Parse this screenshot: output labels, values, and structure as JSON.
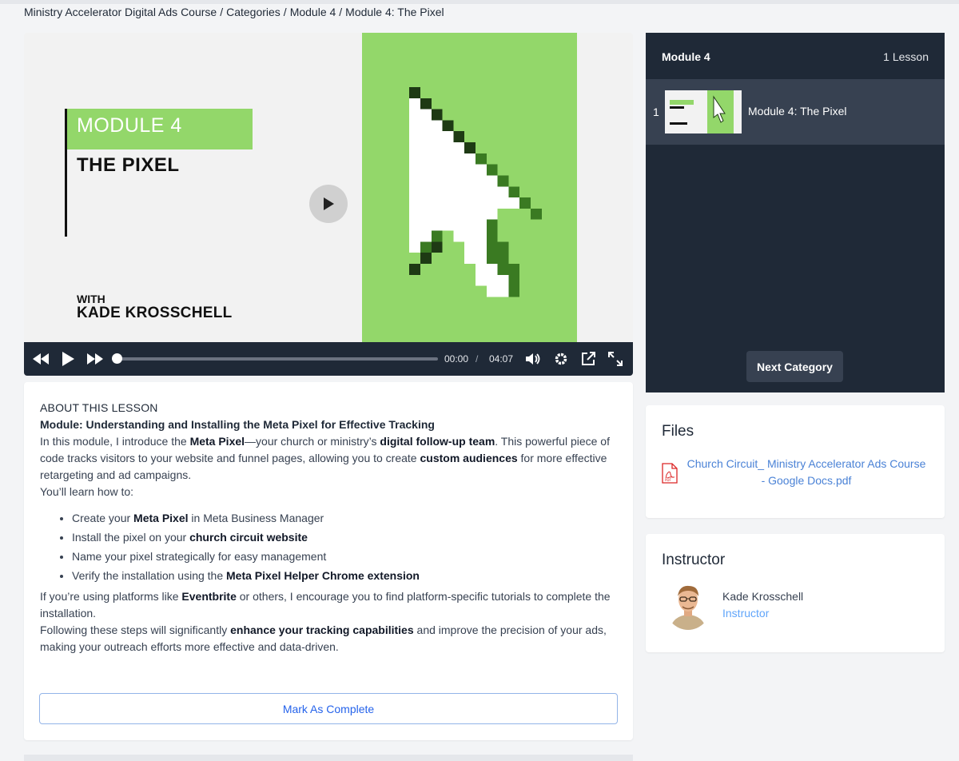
{
  "breadcrumb": {
    "items": [
      "Ministry Accelerator Digital Ads Course",
      "Categories",
      "Module 4",
      "Module 4: The Pixel"
    ],
    "separator": "/"
  },
  "video": {
    "thumbnail": {
      "module_label": "MODULE 4",
      "title": "THE PIXEL",
      "with_label": "WITH",
      "presenter": "KADE KROSSCHELL"
    },
    "current_time": "00:00",
    "time_separator": "/",
    "duration": "04:07",
    "progress": 0,
    "icons": [
      "rewind-icon",
      "play-icon",
      "fast-forward-icon",
      "volume-icon",
      "settings-icon",
      "popout-icon",
      "fullscreen-icon"
    ]
  },
  "about": {
    "heading": "ABOUT THIS LESSON",
    "subheading": "Module: Understanding and Installing the Meta Pixel for Effective Tracking",
    "intro": {
      "t1": "In this module, I introduce the ",
      "b1": "Meta Pixel",
      "t2": "—your church or ministry’s ",
      "b2": "digital follow-up team",
      "t3": ". This powerful piece of code tracks visitors to your website and funnel pages, allowing you to create ",
      "b3": "custom audiences",
      "t4": " for more effective retargeting and ad campaigns."
    },
    "learn_intro": "You’ll learn how to:",
    "bullets": [
      {
        "a": "Create your ",
        "b": "Meta Pixel",
        "c": " in Meta Business Manager"
      },
      {
        "a": "Install the pixel on your ",
        "b": "church circuit website",
        "c": ""
      },
      {
        "a": "Name your pixel strategically for easy management",
        "b": "",
        "c": ""
      },
      {
        "a": "Verify the installation using the ",
        "b": "Meta Pixel Helper Chrome extension",
        "c": ""
      }
    ],
    "platforms": {
      "t1": "If you’re using platforms like ",
      "b1": "Eventbrite",
      "t2": " or others, I encourage you to find platform-specific tutorials to complete the installation."
    },
    "closing": {
      "t1": "Following these steps will significantly ",
      "b1": "enhance your tracking capabilities",
      "t2": " and improve the precision of your ads, making your outreach efforts more effective and data-driven."
    },
    "complete_button": "Mark As Complete"
  },
  "sidebar": {
    "title": "Module 4",
    "lesson_count": "1 Lesson",
    "lessons": [
      {
        "number": "1",
        "title": "Module 4: The Pixel"
      }
    ],
    "next_button": "Next Category"
  },
  "files": {
    "title": "Files",
    "file_line1": "Church Circuit_ Ministry Accelerator Ads Course",
    "file_line2": "- Google Docs.pdf",
    "icon": "pdf-file-icon"
  },
  "instructor": {
    "title": "Instructor",
    "name": "Kade Krosschell",
    "role": "Instructor"
  },
  "colors": {
    "accent_green": "#93d76a",
    "dark_panel": "#1f2937",
    "link_blue": "#4a82d6"
  }
}
